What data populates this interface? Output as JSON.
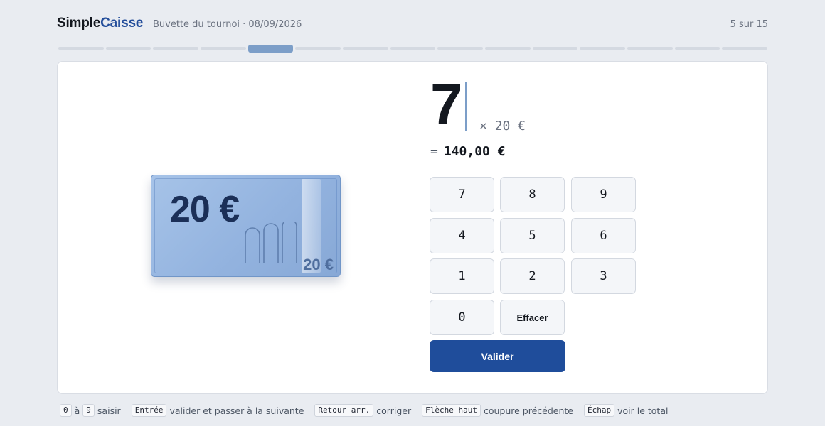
{
  "header": {
    "brand_part1": "Simple",
    "brand_part2": "Caisse",
    "subtitle": "Buvette du tournoi · 08/09/2026",
    "counter": "5 sur 15"
  },
  "progress": {
    "total_steps": 15,
    "current_step": 5
  },
  "banknote": {
    "value_label": "20 €",
    "small_label": "20 €"
  },
  "entry": {
    "quantity": "7",
    "unit_label": "× 20 €",
    "equals": "=",
    "total": "140,00 €"
  },
  "keypad": {
    "keys": [
      "7",
      "8",
      "9",
      "4",
      "5",
      "6",
      "1",
      "2",
      "3",
      "0"
    ],
    "clear_label": "Effacer",
    "validate_label": "Valider"
  },
  "hints": {
    "digit_from": "0",
    "range_word": "à",
    "digit_to": "9",
    "digit_action": "saisir",
    "enter_key": "Entrée",
    "enter_action": "valider et passer à la suivante",
    "backspace_key": "Retour arr.",
    "backspace_action": "corriger",
    "up_key": "Flèche haut",
    "up_action": "coupure précédente",
    "esc_key": "Échap",
    "esc_action": "voir le total"
  },
  "colors": {
    "accent": "#1f4d9b",
    "brand_blue": "#234d9a",
    "progress_active": "#7c9ec8",
    "note_fill": "#93b3df"
  }
}
